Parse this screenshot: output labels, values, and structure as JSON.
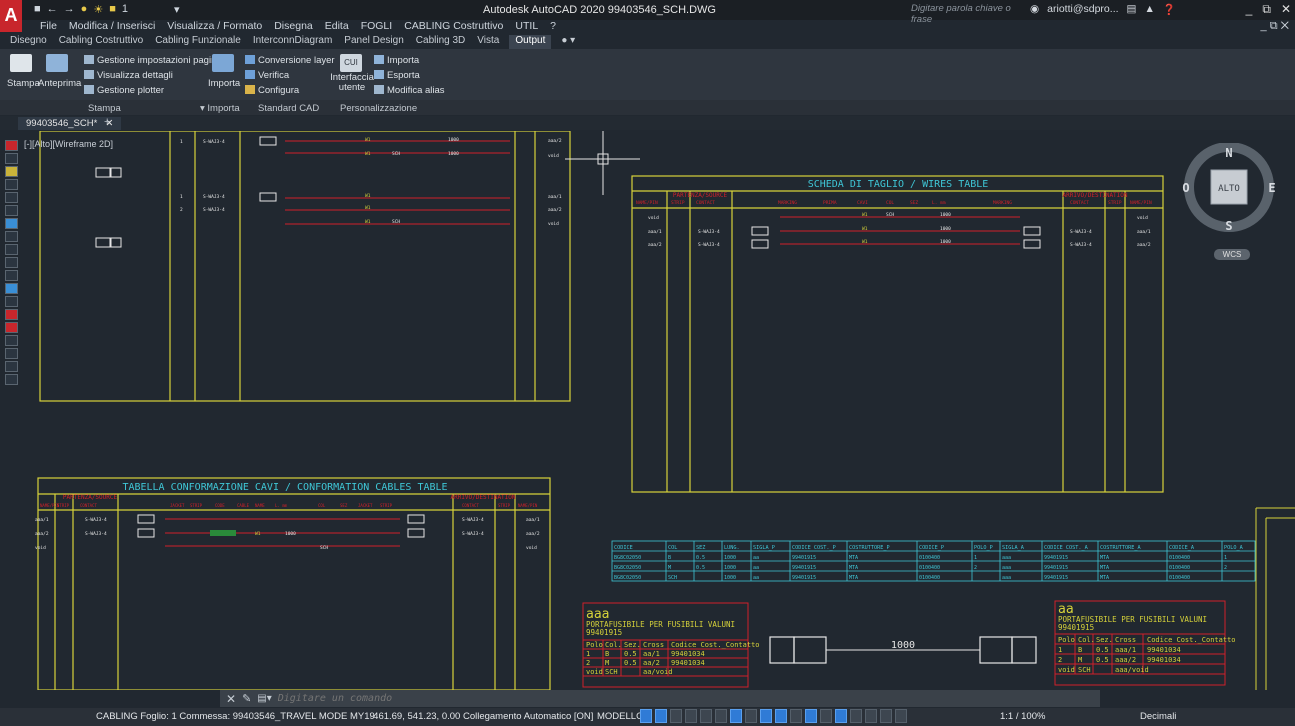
{
  "titlebar": {
    "logo": "A",
    "title": "Autodesk AutoCAD 2020   99403546_SCH.DWG",
    "search_placeholder": "Digitare parola chiave o frase",
    "user": "ariotti@sdpro...",
    "qat_layer": "1"
  },
  "menubar": {
    "items": [
      "File",
      "Modifica / Inserisci",
      "Visualizza / Formato",
      "Disegna",
      "Edita",
      "FOGLI",
      "CABLING Costruttivo",
      "UTIL",
      "?"
    ]
  },
  "ribbon_tabs": [
    "Disegno",
    "Cabling Costruttivo",
    "Cabling Funzionale",
    "InterconnDiagram",
    "Panel Design",
    "Cabling 3D",
    "Vista",
    "Output"
  ],
  "ribbon_active_tab": "Output",
  "ribbon": {
    "stampa": "Stampa",
    "anteprima": "Anteprima",
    "gestione_impostazioni": "Gestione impostazioni pagina",
    "visualizza_dettagli": "Visualizza dettagli",
    "gestione_plotter": "Gestione plotter",
    "importa": "Importa",
    "conversione_layer": "Conversione layer",
    "verifica": "Verifica",
    "configura": "Configura",
    "cui": "CUI",
    "interfaccia_utente": "Interfaccia utente",
    "importa2": "Importa",
    "esporta": "Esporta",
    "modifica_alias": "Modifica alias",
    "panel_stampa": "Stampa",
    "panel_importa": "Importa",
    "panel_standard": "Standard CAD",
    "panel_personalizzazione": "Personalizzazione"
  },
  "doc_tab": {
    "name": "99403546_SCH*",
    "close": "✕",
    "add": "+"
  },
  "viewport_label": "[-][Alto][Wireframe 2D]",
  "drawing": {
    "wires_table_title": "SCHEDA DI TAGLIO / WIRES TABLE",
    "wires_source": "PARTENZA/SOURCE",
    "wires_dest": "ARRIVO/DESTINATION",
    "wires_headers": [
      "NAME/PIN",
      "STRIP",
      "CONTACT",
      "MARKING",
      "PRIMA",
      "CAVI",
      "COL",
      "SEZ",
      "L. mm",
      "MARKING",
      "CONTACT",
      "STRIP",
      "NAME/PIN"
    ],
    "conf_table_title": "TABELLA CONFORMAZIONE CAVI / CONFORMATION CABLES TABLE",
    "conf_source": "PARTENZA/SOURCE",
    "conf_dest": "ARRIVO/DESTINATION",
    "conf_headers": [
      "NAME/PIN",
      "STRIP",
      "CONTACT",
      "JACKET",
      "STRIP",
      "CODE",
      "CABLE",
      "NAME",
      "L. mm",
      "COL",
      "SEZ",
      "JACKET",
      "STRIP",
      "CONTACT",
      "STRIP",
      "NAME/PIN"
    ],
    "schematic_label_1": "1",
    "schematic_label_2": "2",
    "schematic_wire_w1": "W1",
    "schematic_sch": "SCH",
    "schematic_1000": "1000",
    "schematic_pin": "S-WAJ3-4",
    "schematic_tag_1": "aaa/1",
    "schematic_tag_2": "aaa/2",
    "schematic_void": "void",
    "small_table": {
      "headers": [
        "CODICE",
        "COL",
        "SEZ",
        "LUNG.",
        "SIGLA_P",
        "CODICE COST._P",
        "COSTRUTTORE_P",
        "CODICE_P",
        "POLO_P",
        "SIGLA_A",
        "CODICE COST._A",
        "COSTRUTTORE_A",
        "CODICE_A",
        "POLO_A"
      ],
      "rows": [
        [
          "BG8C02050",
          "B",
          "0.5",
          "1000",
          "aa",
          "99401915",
          "MTA",
          "0100400",
          "1",
          "aaa",
          "99401915",
          "MTA",
          "0100400",
          "1"
        ],
        [
          "BG8C02050",
          "M",
          "0.5",
          "1000",
          "aa",
          "99401915",
          "MTA",
          "0100400",
          "2",
          "aaa",
          "99401915",
          "MTA",
          "0100400",
          "2"
        ],
        [
          "BG8C02050",
          "SCH",
          "",
          "1000",
          "aa",
          "99401915",
          "MTA",
          "0100400",
          "",
          "aaa",
          "99401915",
          "MTA",
          "0100400",
          ""
        ]
      ]
    },
    "box_left": {
      "name": "aaa",
      "desc": "PORTAFUSIBILE PER FUSIBILI VALUNI",
      "code": "99401915",
      "headers": [
        "Polo",
        "Col.",
        "Sez.",
        "Cross",
        "Codice Cost._Contatto"
      ],
      "rows": [
        [
          "1",
          "B",
          "0.5",
          "aa/1",
          "99401034"
        ],
        [
          "2",
          "M",
          "0.5",
          "aa/2",
          "99401034"
        ],
        [
          "void",
          "SCH",
          "",
          "aa/void",
          ""
        ]
      ]
    },
    "box_right": {
      "name": "aa",
      "desc": "PORTAFUSIBILE PER FUSIBILI VALUNI",
      "code": "99401915",
      "headers": [
        "Polo",
        "Col.",
        "Sez.",
        "Cross",
        "Codice Cost._Contatto"
      ],
      "rows": [
        [
          "1",
          "B",
          "0.5",
          "aaa/1",
          "99401034"
        ],
        [
          "2",
          "M",
          "0.5",
          "aaa/2",
          "99401034"
        ],
        [
          "void",
          "SCH",
          "",
          "aaa/void",
          ""
        ]
      ]
    },
    "cable_length": "1000"
  },
  "viewcube": {
    "north": "N",
    "south": "S",
    "east": "E",
    "west": "O",
    "face": "ALTO",
    "wcs": "WCS"
  },
  "command": {
    "placeholder": "Digitare un comando"
  },
  "status": {
    "left": "CABLING Foglio: 1   Commessa: 99403546_TRAVEL MODE MY19",
    "coords": "-461.69, 541.23, 0.00  Collegamento Automatico [ON]",
    "model": "MODELLO",
    "scale": "1:1 / 100%",
    "units": "Decimali"
  },
  "colors": {
    "background": "#212830",
    "yellow": "#d6d23a",
    "red": "#d0202a",
    "cyan": "#3fc6d6",
    "white": "#e6e6e6"
  }
}
